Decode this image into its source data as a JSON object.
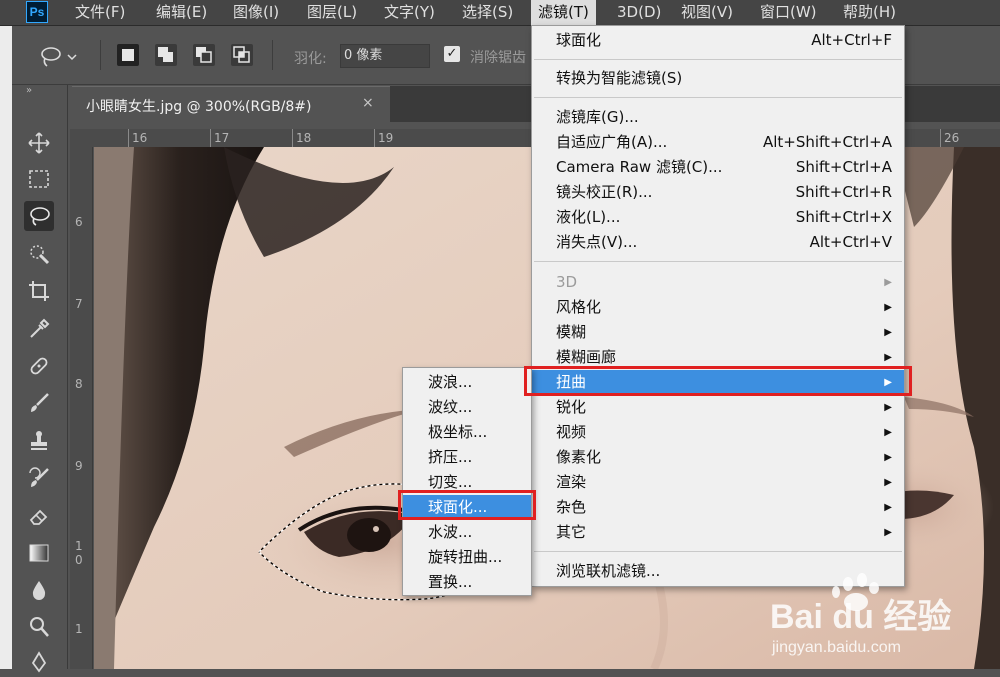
{
  "app": {
    "logo": "Ps"
  },
  "menubar": {
    "items": [
      {
        "label": "文件(F)"
      },
      {
        "label": "编辑(E)"
      },
      {
        "label": "图像(I)"
      },
      {
        "label": "图层(L)"
      },
      {
        "label": "文字(Y)"
      },
      {
        "label": "选择(S)"
      },
      {
        "label": "滤镜(T)",
        "active": true
      },
      {
        "label": "3D(D)"
      },
      {
        "label": "视图(V)"
      },
      {
        "label": "窗口(W)"
      },
      {
        "label": "帮助(H)"
      }
    ]
  },
  "options_bar": {
    "feather_label": "羽化:",
    "feather_value": "0 像素",
    "antialias_checked": true,
    "antialias_label": "消除锯齿"
  },
  "document": {
    "tab_title": "小眼睛女生.jpg @ 300%(RGB/8#)",
    "close_glyph": "×"
  },
  "rulers": {
    "horizontal": [
      "16",
      "17",
      "18",
      "19",
      "26"
    ],
    "vertical": [
      "6",
      "7",
      "8",
      "9",
      "10",
      "1"
    ]
  },
  "filter_menu": {
    "items": [
      {
        "label": "球面化",
        "shortcut": "Alt+Ctrl+F"
      },
      {
        "label": "转换为智能滤镜(S)"
      },
      {
        "label": "滤镜库(G)..."
      },
      {
        "label": "自适应广角(A)...",
        "shortcut": "Alt+Shift+Ctrl+A"
      },
      {
        "label": "Camera Raw 滤镜(C)...",
        "shortcut": "Shift+Ctrl+A"
      },
      {
        "label": "镜头校正(R)...",
        "shortcut": "Shift+Ctrl+R"
      },
      {
        "label": "液化(L)...",
        "shortcut": "Shift+Ctrl+X"
      },
      {
        "label": "消失点(V)...",
        "shortcut": "Alt+Ctrl+V"
      },
      {
        "label": "3D",
        "submenu": true,
        "disabled": true
      },
      {
        "label": "风格化",
        "submenu": true
      },
      {
        "label": "模糊",
        "submenu": true
      },
      {
        "label": "模糊画廊",
        "submenu": true
      },
      {
        "label": "扭曲",
        "submenu": true,
        "highlighted": true
      },
      {
        "label": "锐化",
        "submenu": true
      },
      {
        "label": "视频",
        "submenu": true
      },
      {
        "label": "像素化",
        "submenu": true
      },
      {
        "label": "渲染",
        "submenu": true
      },
      {
        "label": "杂色",
        "submenu": true
      },
      {
        "label": "其它",
        "submenu": true
      },
      {
        "label": "浏览联机滤镜..."
      }
    ],
    "submenu_arrow": "▶"
  },
  "distort_submenu": {
    "items": [
      {
        "label": "波浪..."
      },
      {
        "label": "波纹..."
      },
      {
        "label": "极坐标..."
      },
      {
        "label": "挤压..."
      },
      {
        "label": "切变..."
      },
      {
        "label": "球面化...",
        "highlighted": true
      },
      {
        "label": "水波..."
      },
      {
        "label": "旋转扭曲..."
      },
      {
        "label": "置换..."
      }
    ]
  },
  "toolbar": {
    "tools": [
      "move-tool",
      "marquee-tool",
      "lasso-tool",
      "quick-selection-tool",
      "crop-tool",
      "eyedropper-tool",
      "healing-brush-tool",
      "brush-tool",
      "clone-stamp-tool",
      "history-brush-tool",
      "eraser-tool",
      "gradient-tool",
      "blur-tool",
      "dodge-tool",
      "pen-tool"
    ],
    "active": "lasso-tool"
  },
  "watermark": {
    "brand": "Bai du 经验",
    "url": "jingyan.baidu.com"
  },
  "colors": {
    "highlight": "#3d8fe0",
    "annotation_red": "#e02020",
    "menu_bg": "#f0f0f0",
    "ui_dark": "#535353"
  }
}
